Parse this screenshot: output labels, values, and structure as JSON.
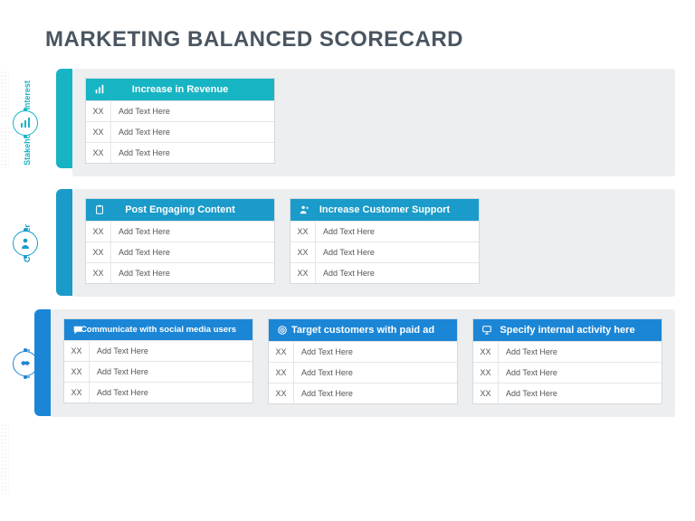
{
  "title": "MARKETING BALANCED SCORECARD",
  "colors": {
    "teal": "#17b4c4",
    "cyan": "#1a9bc9",
    "blue": "#1c86d6"
  },
  "sections": [
    {
      "label": "Stakeholder's Interest",
      "theme": "teal",
      "icon": "bar-chart",
      "cards": [
        {
          "header": "Increase in Revenue",
          "icon": "bar-chart",
          "rows": [
            {
              "code": "XX",
              "text": "Add Text Here"
            },
            {
              "code": "XX",
              "text": "Add Text Here"
            },
            {
              "code": "XX",
              "text": "Add Text Here"
            }
          ]
        }
      ]
    },
    {
      "label": "Customer",
      "theme": "cyan",
      "icon": "person",
      "cards": [
        {
          "header": "Post Engaging Content",
          "icon": "clipboard",
          "rows": [
            {
              "code": "XX",
              "text": "Add Text Here"
            },
            {
              "code": "XX",
              "text": "Add Text Here"
            },
            {
              "code": "XX",
              "text": "Add Text Here"
            }
          ]
        },
        {
          "header": "Increase Customer Support",
          "icon": "person-plus",
          "rows": [
            {
              "code": "XX",
              "text": "Add Text Here"
            },
            {
              "code": "XX",
              "text": "Add Text Here"
            },
            {
              "code": "XX",
              "text": "Add Text Here"
            }
          ]
        }
      ]
    },
    {
      "label": "Internal",
      "theme": "blue",
      "icon": "handshake",
      "cards": [
        {
          "header": "Communicate with social media users",
          "icon": "chat",
          "rows": [
            {
              "code": "XX",
              "text": "Add Text Here"
            },
            {
              "code": "XX",
              "text": "Add Text Here"
            },
            {
              "code": "XX",
              "text": "Add Text Here"
            }
          ]
        },
        {
          "header": "Target customers with paid ad",
          "icon": "target",
          "rows": [
            {
              "code": "XX",
              "text": "Add Text Here"
            },
            {
              "code": "XX",
              "text": "Add Text Here"
            },
            {
              "code": "XX",
              "text": "Add Text Here"
            }
          ]
        },
        {
          "header": "Specify internal activity here",
          "icon": "monitor",
          "rows": [
            {
              "code": "XX",
              "text": "Add Text Here"
            },
            {
              "code": "XX",
              "text": "Add Text Here"
            },
            {
              "code": "XX",
              "text": "Add Text Here"
            }
          ]
        }
      ]
    }
  ]
}
